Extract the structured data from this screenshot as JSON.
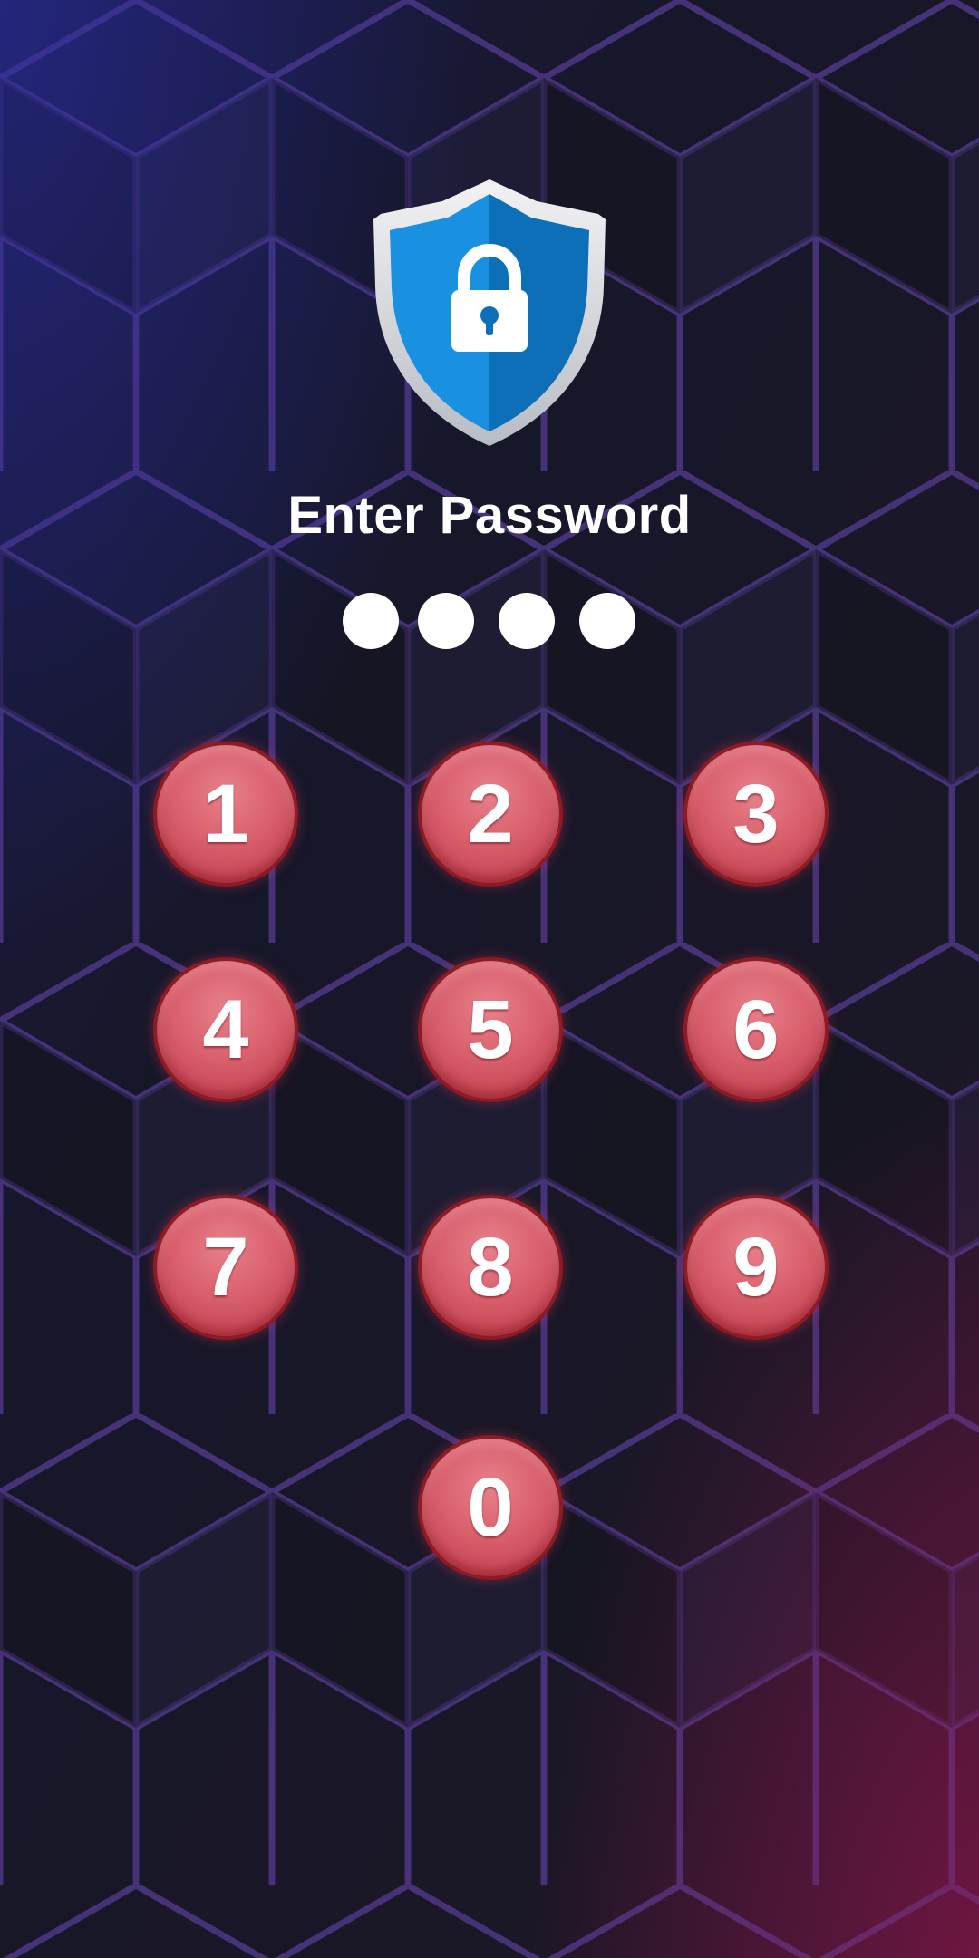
{
  "title": "Enter Password",
  "pin": {
    "entered_count": 4,
    "length": 4
  },
  "keypad": {
    "keys": [
      "1",
      "2",
      "3",
      "4",
      "5",
      "6",
      "7",
      "8",
      "9",
      "0"
    ]
  },
  "colors": {
    "key_fill": "#d9606d",
    "key_border": "#8e1a24",
    "shield_blue": "#1188d8",
    "background": "#1a1826"
  },
  "icons": {
    "logo": "shield-lock-icon"
  }
}
